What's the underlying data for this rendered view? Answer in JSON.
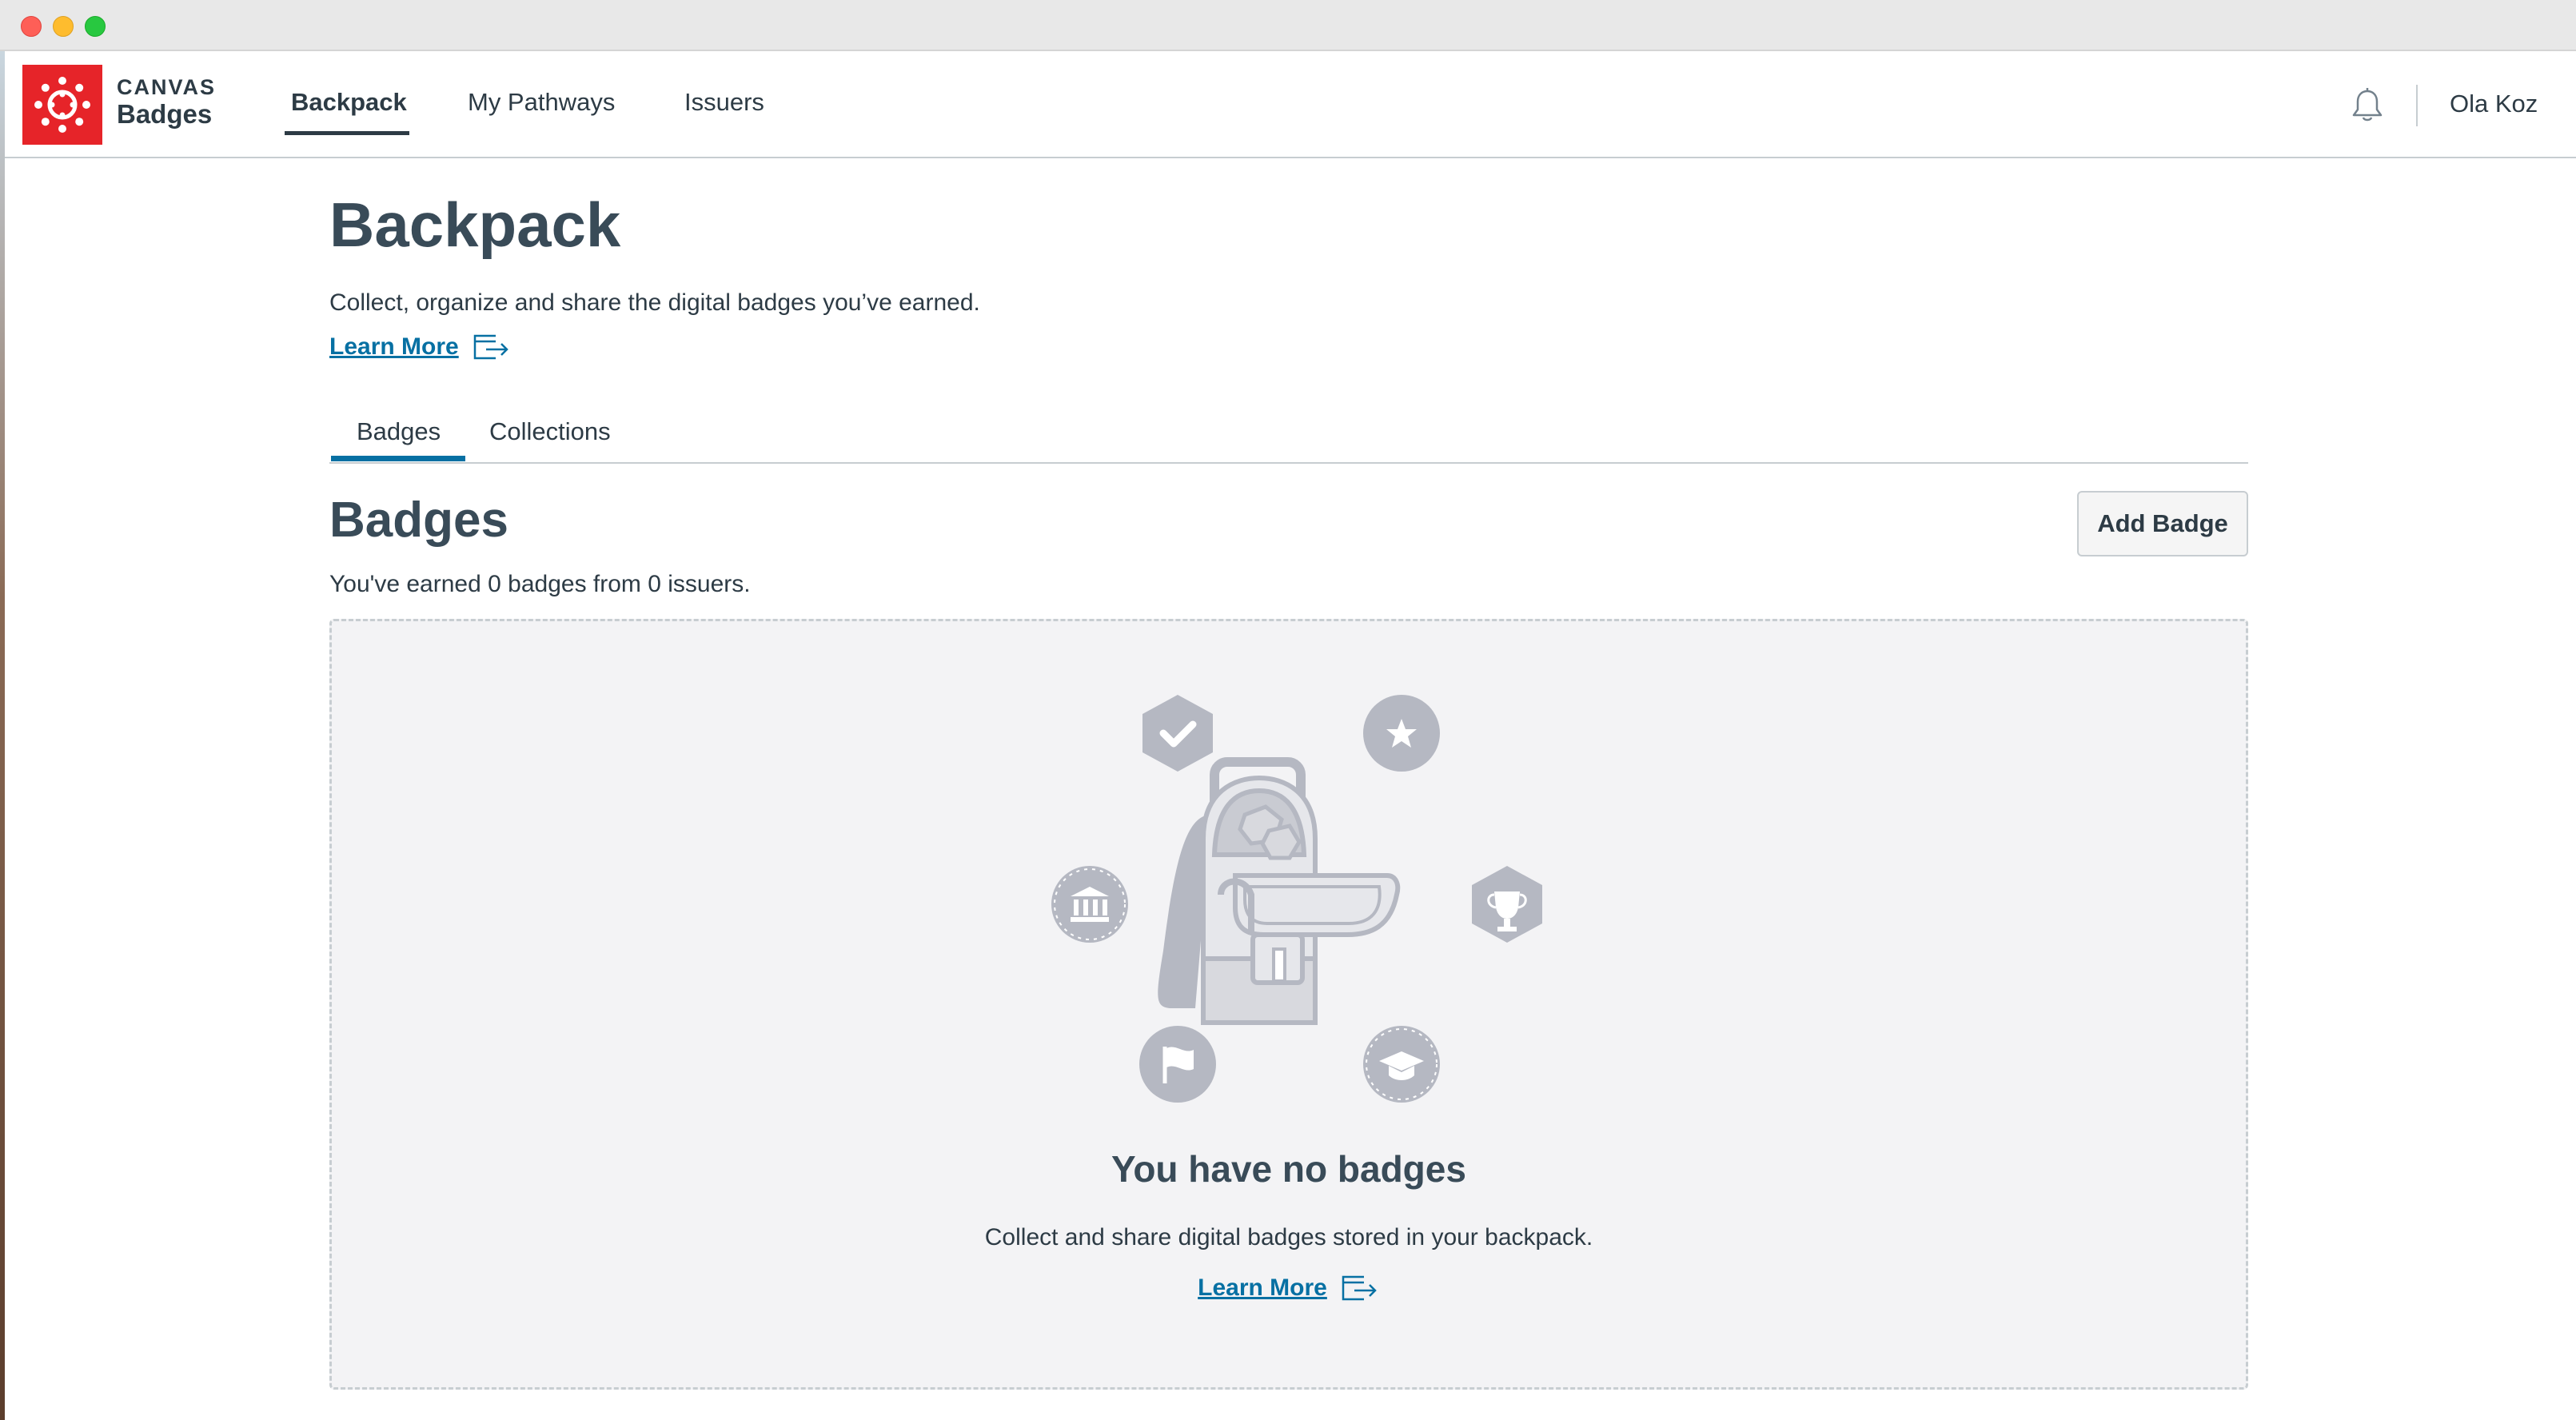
{
  "window": {
    "controls": [
      "close",
      "minimize",
      "zoom"
    ]
  },
  "header": {
    "logo": {
      "line1": "CANVAS",
      "line2": "Badges",
      "icon": "canvas-logo-icon",
      "color": "#e62429"
    },
    "nav": [
      {
        "label": "Backpack",
        "active": true
      },
      {
        "label": "My Pathways",
        "active": false
      },
      {
        "label": "Issuers",
        "active": false
      }
    ],
    "notifications_icon": "bell-icon",
    "user_name": "Ola Koz"
  },
  "page": {
    "title": "Backpack",
    "subtitle": "Collect, organize and share the digital badges you’ve earned.",
    "learn_more": "Learn More",
    "tabs": [
      {
        "label": "Badges",
        "active": true
      },
      {
        "label": "Collections",
        "active": false
      }
    ]
  },
  "badges_section": {
    "title": "Badges",
    "add_button": "Add Badge",
    "earned_text": "You've earned 0 badges from 0 issuers.",
    "empty_state": {
      "title": "You have no badges",
      "description": "Collect and share digital badges stored in your backpack.",
      "learn_more": "Learn More",
      "illustration": "backpack-with-badges-illustration"
    }
  },
  "colors": {
    "link": "#0770a3",
    "text": "#2d3b45",
    "heading": "#394b58",
    "brand_red": "#e62429",
    "empty_bg": "#f3f3f5",
    "illustration_gray": "#b5b8c2"
  }
}
